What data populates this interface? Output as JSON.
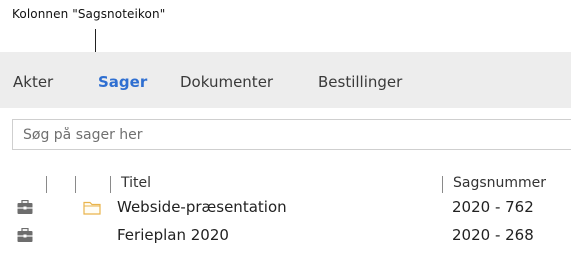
{
  "annotation": {
    "text": "Kolonnen \"Sagsnoteikon\""
  },
  "tabs": [
    {
      "label": "Akter",
      "active": false
    },
    {
      "label": "Sager",
      "active": true
    },
    {
      "label": "Dokumenter",
      "active": false
    },
    {
      "label": "Bestillinger",
      "active": false
    }
  ],
  "search": {
    "placeholder": "Søg på sager her",
    "value": ""
  },
  "table": {
    "columns": [
      {
        "label": ""
      },
      {
        "label": ""
      },
      {
        "label": ""
      },
      {
        "label": "Titel"
      },
      {
        "label": "Sagsnummer"
      }
    ],
    "rows": [
      {
        "icon": "case-icon",
        "has_note": true,
        "note_icon": "note-icon",
        "title": "Webside-præsentation",
        "case_number": "2020 - 762"
      },
      {
        "icon": "case-icon",
        "has_note": false,
        "title": "Ferieplan 2020",
        "case_number": "2020 - 268"
      }
    ]
  },
  "colors": {
    "accent": "#2f6fd1",
    "tabbar_bg": "#ededed",
    "note_icon": "#e9b44c",
    "case_icon": "#6d6d6d"
  }
}
